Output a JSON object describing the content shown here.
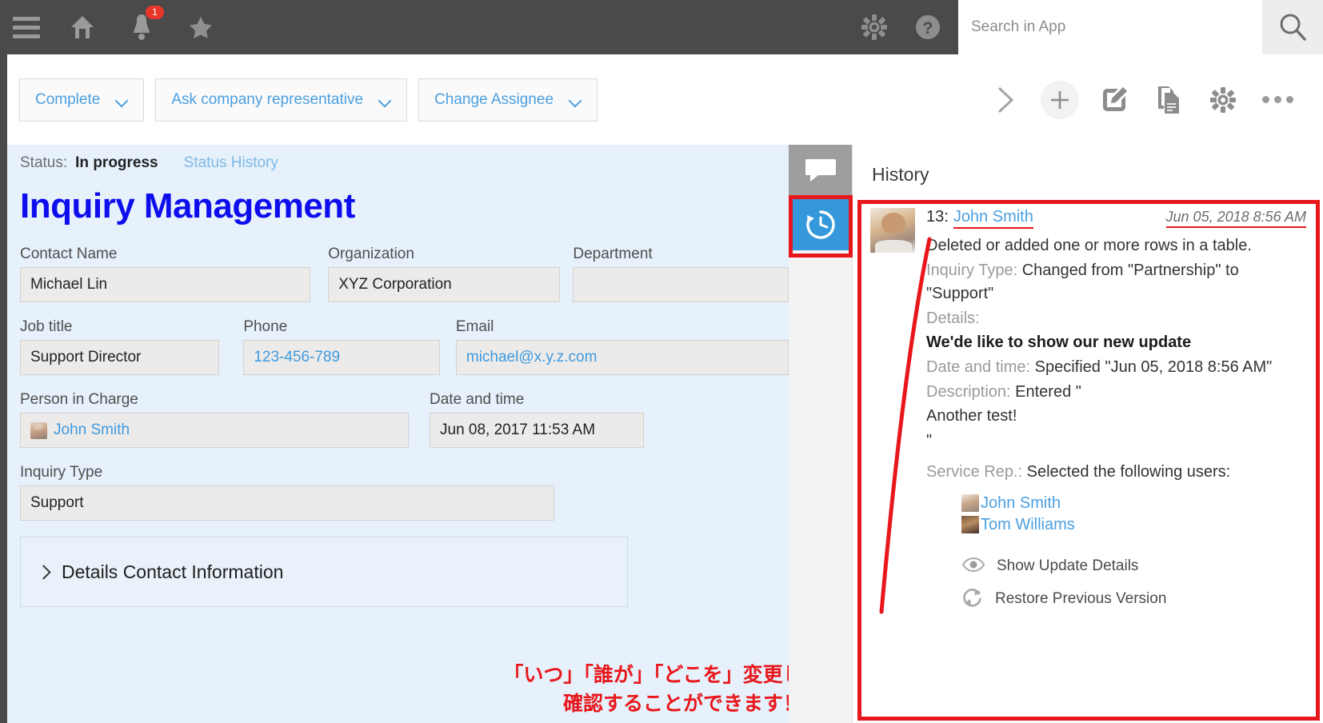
{
  "topbar": {
    "icons": [
      {
        "name": "hamburger-menu-icon",
        "label": "Menu"
      },
      {
        "name": "home-icon",
        "label": "Home"
      },
      {
        "name": "bell-icon",
        "label": "Notifications"
      },
      {
        "name": "star-icon",
        "label": "Favorites"
      }
    ],
    "notification_badge": "1",
    "gear_label": "Settings",
    "help_label": "Help",
    "search": {
      "placeholder": "Search in App",
      "value": "",
      "button_icon": "search-icon"
    }
  },
  "actionbar": {
    "buttons": [
      {
        "label": "Complete"
      },
      {
        "label": "Ask company representative"
      },
      {
        "label": "Change Assignee"
      }
    ],
    "icons": [
      {
        "name": "chevron-right-icon"
      },
      {
        "name": "plus-icon"
      },
      {
        "name": "edit-icon"
      },
      {
        "name": "copy-document-icon"
      },
      {
        "name": "gear-icon"
      },
      {
        "name": "more-options-icon"
      }
    ]
  },
  "record": {
    "status_label": "Status:",
    "status_value": "In progress",
    "status_history_link": "Status History",
    "title": "Inquiry Management",
    "fields": [
      {
        "label": "Contact Name",
        "value": "Michael Lin",
        "style": "plain"
      },
      {
        "label": "Organization",
        "value": "XYZ Corporation",
        "style": "plain"
      },
      {
        "label": "Department",
        "value": "",
        "style": "plain"
      },
      {
        "label": "Job title",
        "value": "Support Director",
        "style": "plain"
      },
      {
        "label": "Phone",
        "value": "123-456-789",
        "style": "link"
      },
      {
        "label": "Email",
        "value": "michael@x.y.z.com",
        "style": "link"
      },
      {
        "label": "Person in Charge",
        "value": "John Smith",
        "style": "user"
      },
      {
        "label": "Date and time",
        "value": "Jun 08, 2017 11:53 AM",
        "style": "plain"
      },
      {
        "label": "Inquiry Type",
        "value": "Support",
        "style": "plain"
      }
    ],
    "details_section": "Details Contact Information"
  },
  "annotation": {
    "line1": "「いつ」「誰が」「どこを」変更したかを",
    "line2": "確認することができます！",
    "color": "#e8171c"
  },
  "tabs": [
    {
      "name": "comments-tab",
      "icon": "speech-bubble-icon",
      "active": false
    },
    {
      "name": "history-tab",
      "icon": "history-clock-icon",
      "active": true
    }
  ],
  "history": {
    "title": "History",
    "entry": {
      "number": "13:",
      "user": "John Smith",
      "timestamp": "Jun 05, 2018 8:56 AM",
      "summary": "Deleted or added one or more rows in a table.",
      "changes": [
        {
          "label": "Inquiry Type:",
          "text": " Changed from \"Partnership\" to \"Support\"",
          "bold": false
        },
        {
          "label": "Details:",
          "text": "",
          "bold": false
        },
        {
          "label": "",
          "text": "We'de like to show our new update",
          "bold": true
        },
        {
          "label": "Date and time:",
          "text": " Specified \"Jun 05, 2018 8:56 AM\"",
          "bold": false
        },
        {
          "label": "Description:",
          "text": " Entered \"",
          "bold": false
        },
        {
          "label": "",
          "text": "Another test!",
          "bold": false
        },
        {
          "label": "",
          "text": "\"",
          "bold": false
        },
        {
          "label": "Service Rep.:",
          "text": " Selected the following users:",
          "bold": false
        }
      ],
      "selected_users": [
        {
          "name": "John Smith"
        },
        {
          "name": "Tom Williams"
        }
      ],
      "actions": [
        {
          "icon": "eye-icon",
          "label": "Show Update Details"
        },
        {
          "icon": "restore-refresh-icon",
          "label": "Restore Previous Version"
        }
      ]
    }
  },
  "colors": {
    "topbar_bg": "#4a4a4a",
    "form_bg": "#e6f1fb",
    "accent_blue": "#3498db",
    "title_blue": "#0d0ded",
    "link_blue": "#4b9fe0",
    "annotation_red": "#e8171c",
    "field_bg": "#ecebe9"
  }
}
